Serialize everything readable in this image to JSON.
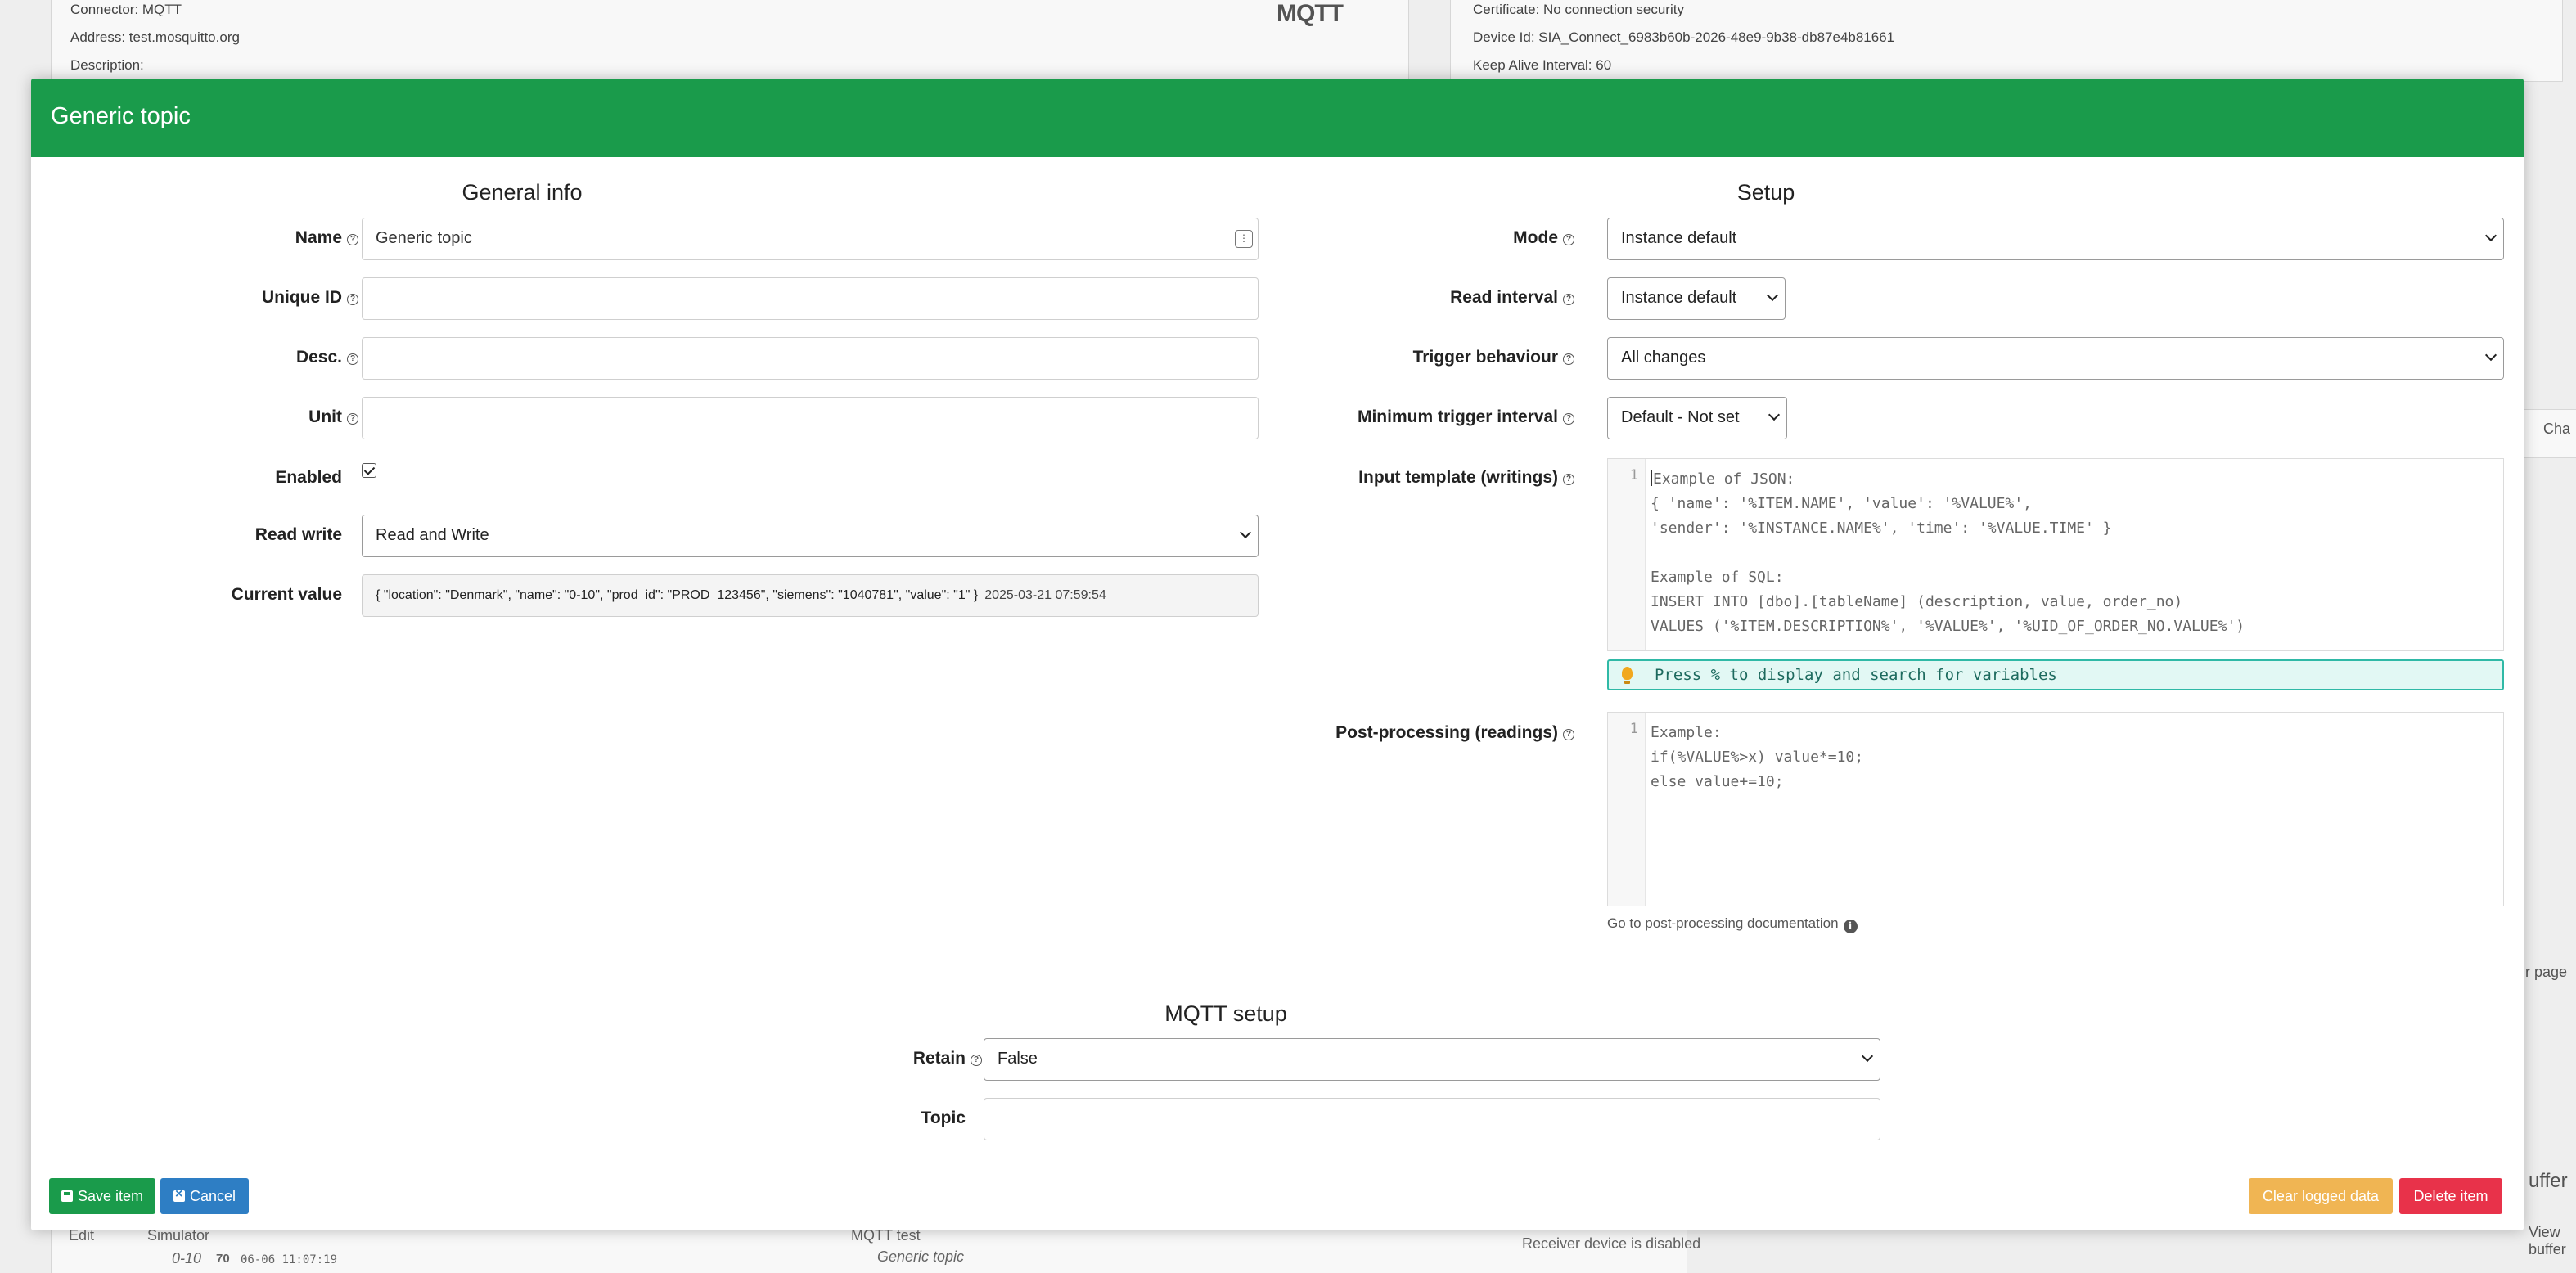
{
  "background": {
    "connector": "Connector: MQTT",
    "address": "Address: test.mosquitto.org",
    "description": "Description:",
    "logo": "MQTT",
    "certificate": "Certificate: No connection security",
    "device_id": "Device Id: SIA_Connect_6983b60b-2026-48e9-9b38-db87e4b81661",
    "keep_alive": "Keep Alive Interval: 60",
    "edit": "Edit",
    "simulator": "Simulator",
    "mqtt_test": "MQTT test",
    "item_row_name": "0-10",
    "item_row_value": "70",
    "item_row_time": "06-06 11:07:19",
    "generic_topic": "Generic topic",
    "receiver_disabled": "Receiver device is disabled",
    "chart_link": "Cha",
    "per_page": "r page",
    "buffer": "uffer",
    "view_buffer": "View buffer"
  },
  "modal": {
    "title": "Generic topic",
    "general_info": {
      "heading": "General info",
      "name_label": "Name",
      "name_value": "Generic topic",
      "unique_id_label": "Unique ID",
      "unique_id_value": "",
      "desc_label": "Desc.",
      "desc_value": "",
      "unit_label": "Unit",
      "unit_value": "",
      "enabled_label": "Enabled",
      "enabled": true,
      "read_write_label": "Read write",
      "read_write_value": "Read and Write",
      "current_value_label": "Current value",
      "current_value": "{ \"location\": \"Denmark\", \"name\": \"0-10\", \"prod_id\": \"PROD_123456\", \"siemens\": \"1040781\", \"value\": \"1\" }",
      "current_value_time": "2025-03-21 07:59:54"
    },
    "setup": {
      "heading": "Setup",
      "mode_label": "Mode",
      "mode_value": "Instance default",
      "read_interval_label": "Read interval",
      "read_interval_value": "Instance default",
      "trigger_label": "Trigger behaviour",
      "trigger_value": "All changes",
      "min_trigger_label": "Minimum trigger interval",
      "min_trigger_value": "Default - Not set",
      "input_template_label": "Input template (writings)",
      "input_template_line_number": "1",
      "input_template_lines": [
        "Example of JSON:",
        "{ 'name': '%ITEM.NAME', 'value': '%VALUE%',",
        "'sender': '%INSTANCE.NAME%', 'time': '%VALUE.TIME' }",
        "",
        "Example of SQL:",
        "INSERT INTO [dbo].[tableName] (description, value, order_no)",
        "VALUES ('%ITEM.DESCRIPTION%', '%VALUE%', '%UID_OF_ORDER_NO.VALUE%')"
      ],
      "variables_hint": "Press % to display and search for variables",
      "post_processing_label": "Post-processing (readings)",
      "post_processing_line_number": "1",
      "post_processing_lines": [
        "Example:",
        "if(%VALUE%>x) value*=10;",
        "else value+=10;"
      ],
      "doc_link": "Go to post-processing documentation"
    },
    "mqtt_setup": {
      "heading": "MQTT setup",
      "retain_label": "Retain",
      "retain_value": "False",
      "topic_label": "Topic",
      "topic_value": ""
    },
    "footer": {
      "save_label": "Save item",
      "cancel_label": "Cancel",
      "clear_label": "Clear logged data",
      "delete_label": "Delete item"
    }
  },
  "colors": {
    "header_green": "#1a9b4b",
    "save_green": "#1a9b4b",
    "cancel_blue": "#2e7ec4",
    "clear_orange": "#f0b553",
    "delete_red": "#e8324a",
    "hint_teal": "#2fb9a6"
  },
  "icons": {
    "help": "question-circle-icon",
    "context": "context-menu-icon",
    "info": "info-circle-icon",
    "bulb": "lightbulb-icon",
    "save": "floppy-disk-icon",
    "cancel": "close-square-icon"
  }
}
